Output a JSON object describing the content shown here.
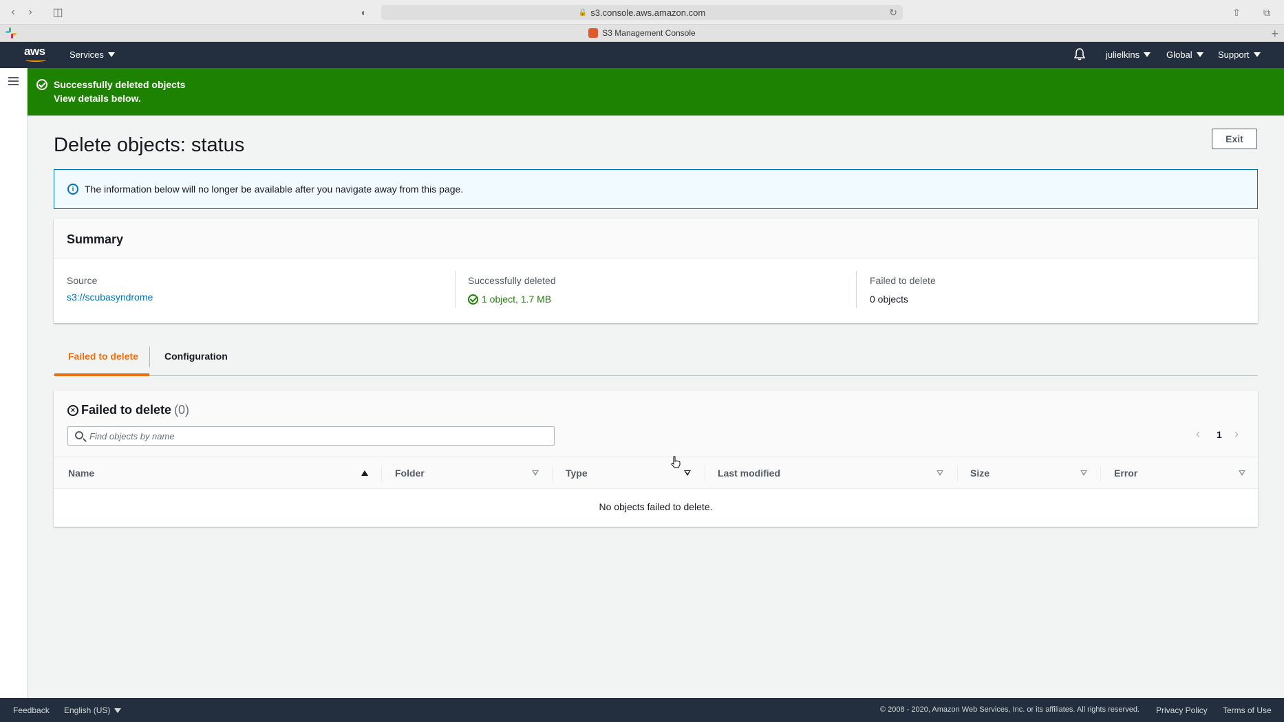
{
  "browser": {
    "url": "s3.console.aws.amazon.com",
    "tab_title": "S3 Management Console"
  },
  "topnav": {
    "logo": "aws",
    "services_label": "Services",
    "user_label": "julielkins",
    "region_label": "Global",
    "support_label": "Support"
  },
  "flash": {
    "title": "Successfully deleted objects",
    "subtitle": "View details below.",
    "color": "#1d8102"
  },
  "page": {
    "title": "Delete objects: status",
    "exit_label": "Exit"
  },
  "info": {
    "text": "The information below will no longer be available after you navigate away from this page."
  },
  "summary": {
    "title": "Summary",
    "source_label": "Source",
    "source_value": "s3://scubasyndrome",
    "deleted_label": "Successfully deleted",
    "deleted_value": "1 object, 1.7 MB",
    "failed_label": "Failed to delete",
    "failed_value": "0 objects"
  },
  "tabs": [
    {
      "label": "Failed to delete",
      "active": true
    },
    {
      "label": "Configuration",
      "active": false
    }
  ],
  "failed_table": {
    "title": "Failed to delete",
    "count": "(0)",
    "search_placeholder": "Find objects by name",
    "page_number": "1",
    "columns": [
      "Name",
      "Folder",
      "Type",
      "Last modified",
      "Size",
      "Error"
    ],
    "empty_message": "No objects failed to delete."
  },
  "footer": {
    "feedback_label": "Feedback",
    "language_label": "English (US)",
    "copyright": "© 2008 - 2020, Amazon Web Services, Inc. or its affiliates. All rights reserved.",
    "privacy_label": "Privacy Policy",
    "terms_label": "Terms of Use"
  },
  "colors": {
    "nav_bg": "#232f3e",
    "accent": "#ec7211",
    "link": "#0073bb",
    "success": "#1d8102"
  }
}
